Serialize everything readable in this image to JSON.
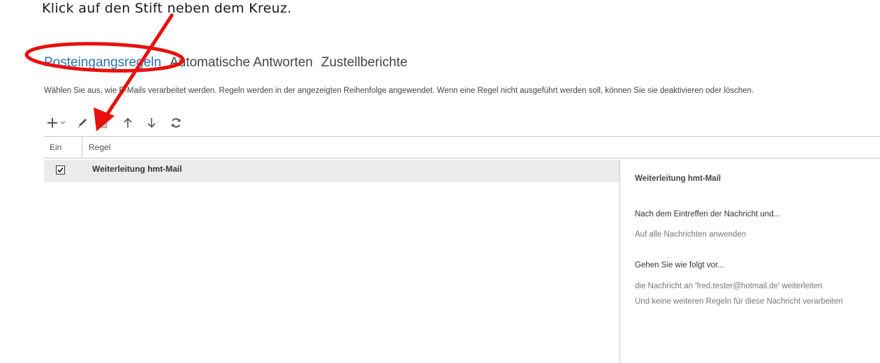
{
  "instruction": "Klick auf den Stift neben dem Kreuz.",
  "tabs": [
    {
      "label": "Posteingangsregeln",
      "active": true
    },
    {
      "label": "Automatische Antworten",
      "active": false
    },
    {
      "label": "Zustellberichte",
      "active": false
    }
  ],
  "description": "Wählen Sie aus, wie E-Mails verarbeitet werden. Regeln werden in der angezeigten Reihenfolge angewendet. Wenn eine Regel nicht ausgeführt werden soll, können Sie sie deaktivieren oder löschen.",
  "toolbar": {
    "icons": [
      "add-icon",
      "dropdown-caret-icon",
      "pencil-icon",
      "trash-icon",
      "arrow-up-icon",
      "arrow-down-icon",
      "refresh-icon"
    ]
  },
  "table": {
    "columns": [
      "Ein",
      "Regel"
    ],
    "rows": [
      {
        "enabled": true,
        "name": "Weiterleitung hmt-Mail"
      }
    ]
  },
  "details": {
    "title": "Weiterleitung hmt-Mail",
    "condition_heading": "Nach dem Eintreffen der Nachricht und...",
    "condition": "Auf alle Nachrichten anwenden",
    "action_heading": "Gehen Sie wie folgt vor...",
    "actions": [
      "die Nachricht an 'fred.tester@hotmail.de' weiterleiten",
      "Und keine weiteren Regeln für diese Nachricht verarbeiten"
    ]
  },
  "colors": {
    "accent": "#2c6fb3",
    "annotation": "#e8100c",
    "row_selected": "#ebebeb"
  }
}
